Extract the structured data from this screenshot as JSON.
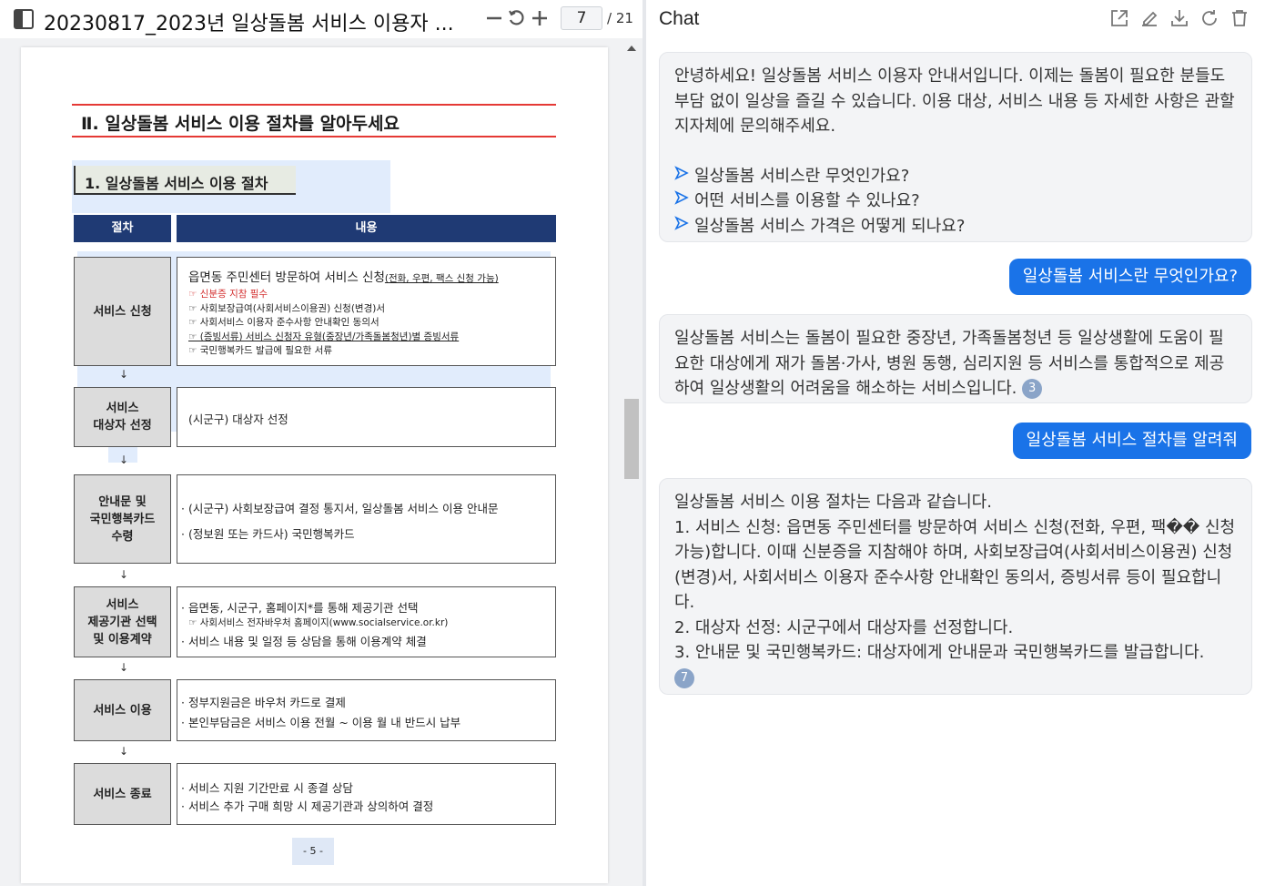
{
  "pdf": {
    "title": "20230817_2023년 일상돌봄 서비스 이용자 ...",
    "page_current": "7",
    "page_total": "/ 21",
    "icons": [
      "sidebar-icon",
      "minus-icon",
      "rotate-icon",
      "plus-icon"
    ]
  },
  "doc": {
    "section_title": "Ⅱ. 일상돌봄 서비스 이용 절차를 알아두세요",
    "subsection_title": "1. 일상돌봄 서비스 이용 절차",
    "col_step": "절차",
    "col_content": "내용",
    "arrow": "↓",
    "steps": [
      {
        "label": "서비스 신청",
        "lines": [
          "읍면동 주민센터 방문하여 서비스 신청",
          "(전화, 우편, 팩스 신청 가능)",
          "☞ 신분증 지참 필수",
          "☞ 사회보장급여(사회서비스이용권) 신청(변경)서",
          "☞ 사회서비스 이용자 준수사항 안내확인 동의서",
          "☞ (증빙서류) 서비스 신청자 유형(중장년/가족돌봄청년)별 증빙서류",
          "☞ 국민행복카드 발급에 필요한 서류"
        ]
      },
      {
        "label": "서비스\n대상자 선정",
        "lines": [
          "(시군구) 대상자 선정"
        ]
      },
      {
        "label": "안내문 및\n국민행복카드\n수령",
        "lines": [
          "· (시군구) 사회보장급여 결정 통지서, 일상돌봄 서비스 이용 안내문",
          "· (정보원 또는 카드사) 국민행복카드"
        ]
      },
      {
        "label": "서비스\n제공기관 선택\n및 이용계약",
        "lines": [
          "· 읍면동, 시군구, 홈페이지*를 통해 제공기관 선택",
          "☞ 사회서비스 전자바우처 홈페이지(www.socialservice.or.kr)",
          "· 서비스 내용 및 일정 등 상담을 통해 이용계약 체결"
        ]
      },
      {
        "label": "서비스 이용",
        "lines": [
          "· 정부지원금은 바우처 카드로 결제",
          "· 본인부담금은 서비스 이용 전월 ~ 이용 월 내 반드시 납부"
        ]
      },
      {
        "label": "서비스 종료",
        "lines": [
          "· 서비스 지원 기간만료 시 종결 상담",
          "· 서비스 추가 구매 희망 시 제공기관과 상의하여 결정"
        ]
      }
    ],
    "page_number": "- 5 -"
  },
  "chat": {
    "title": "Chat",
    "tool_icons": [
      "share-icon",
      "edit-icon",
      "download-icon",
      "refresh-icon",
      "trash-icon"
    ],
    "welcome": "안녕하세요! 일상돌봄 서비스 이용자 안내서입니다. 이제는 돌봄이 필요한 분들도 부담 없이 일상을 즐길 수 있습니다. 이용 대상, 서비스 내용 등 자세한 사항은 관할 지자체에 문의해주세요.",
    "suggestions": [
      "일상돌봄 서비스란 무엇인가요?",
      "어떤 서비스를 이용할 수 있나요?",
      "일상돌봄 서비스 가격은 어떻게 되나요?"
    ],
    "user_1": "일상돌봄 서비스란 무엇인가요?",
    "bot_1": "일상돌봄 서비스는 돌봄이 필요한 중장년, 가족돌봄청년 등 일상생활에 도움이 필요한 대상에게 재가 돌봄·가사, 병원 동행, 심리지원 등 서비스를 통합적으로 제공하여 일상생활의 어려움을 해소하는 서비스입니다.",
    "bot_1_cite": "3",
    "user_2": "일상돌봄 서비스 절차를 알려줘",
    "bot_2_lines": [
      "일상돌봄 서비스 이용 절차는 다음과 같습니다.",
      "1. 서비스 신청: 읍면동 주민센터를 방문하여 서비스 신청(전화, 우편, 팩�� 신청 가능)합니다. 이때 신분증을 지참해야 하며, 사회보장급여(사회서비스이용권) 신청(변경)서, 사회서비스 이용자 준수사항 안내확인 동의서, 증빙서류 등이 필요합니다.",
      "2. 대상자 선정: 시군구에서 대상자를 선정합니다.",
      "3. 안내문 및 국민행복카드: 대상자에게 안내문과 국민행복카드를 발급합니다."
    ],
    "bot_2_cite": "7"
  }
}
